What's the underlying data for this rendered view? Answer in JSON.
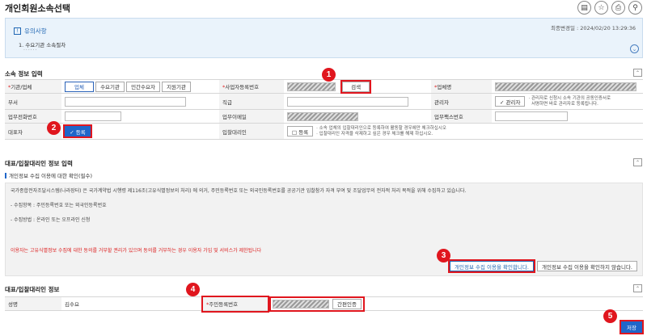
{
  "page": {
    "title": "개인회원소속선택",
    "updated": "최종변경일 : 2024/02/20 13:29:36"
  },
  "top_icons": [
    {
      "name": "manual-icon",
      "glyph": "▤"
    },
    {
      "name": "favorite-icon",
      "glyph": "☆"
    },
    {
      "name": "print-icon",
      "glyph": "⎙"
    },
    {
      "name": "zoom-icon",
      "glyph": "⚲"
    }
  ],
  "notice": {
    "title": "유의사항",
    "item": "1. 수요기관 소속절차",
    "dots": "......"
  },
  "affiliation": {
    "section_title": "소속 정보 입력",
    "org_type_label": "기관/업체",
    "org_types": [
      "업체",
      "수요기관",
      "민간수요자",
      "지원기관"
    ],
    "bizno_label": "사업자등록번호",
    "search_label": "검색",
    "company_label": "업체명",
    "dept_label": "부서",
    "position_label": "직급",
    "manager_label": "관리자",
    "manager_check": "✓ 관리자",
    "manager_hint": "· 관리자로 신청시 소속 기관의 공동인증서로\n  서명하면 바로 관리자로 등록됩니다.",
    "phone_label": "업무전화번호",
    "email_label": "업무이메일",
    "fax_label": "업무팩스번호",
    "rep_label": "대표자",
    "rep_check": "✓ 등록",
    "agent_label": "입찰대리인",
    "agent_check": "□ 등록",
    "agent_hint": "· 소속 업체의 입찰대리인으로 등록하여 활동할 경우에만 체크하십시오\n· 입찰대리인 자격을 삭제하고 싶은 경우 체크를 해제 하십시오."
  },
  "consent": {
    "section_title": "대표/입찰대리인 정보 입력",
    "sub_title": "개인정보 수집 이용에 대한 확인(필수)",
    "text1": "국가종합전자조달시스템(나라장터) 은 국가계약법 시행령 제116조(고유식별정보의 처리) 에 의거, 주민등록번호 또는 외국인등록번호를 공공기관 입찰참가 자격 부여 및 조달업무의 전자적 처리 목적을 위해 수집하고 있습니다.",
    "text2": "- 수집항목 : 주민등록번호 또는 외국인등록번호",
    "text3": "- 수집방법 : 온라인 또는 오프라인 신청",
    "warning": "이용자는 고유식별정보 수집에 대한 동의를 거부할 권리가 있으며 동의를 거부하는 경우 이용자 가입 및 서비스가 제한됩니다",
    "agree_label": "개인정보 수집 이용을 확인합니다.",
    "disagree_label": "개인정보 수집 이용을 확인하지 않습니다."
  },
  "rep_info": {
    "section_title": "대표/입찰대리인 정보",
    "name_label": "성명",
    "name_value": "김수요",
    "rrn_label": "주민등록번호",
    "cert_label": "간편인증"
  },
  "save_label": "저장",
  "badges": [
    "1",
    "2",
    "3",
    "4",
    "5"
  ],
  "colors": {
    "accent": "#1f66c9",
    "highlight": "#e0161e",
    "notice_bg": "#eaf3fb"
  }
}
